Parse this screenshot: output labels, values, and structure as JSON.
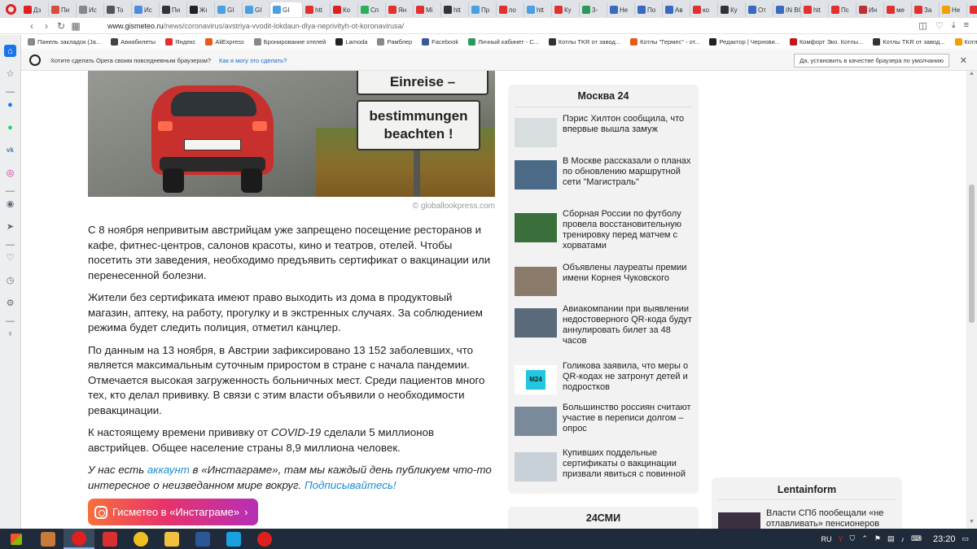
{
  "browser": {
    "tabs": [
      {
        "label": "Дз",
        "color": "#e0201c"
      },
      {
        "label": "Пи",
        "color": "#d84c3c"
      },
      {
        "label": "Ис",
        "color": "#888888"
      },
      {
        "label": "To",
        "color": "#555555"
      },
      {
        "label": "Ис",
        "color": "#4c8be0"
      },
      {
        "label": "Пи",
        "color": "#333333"
      },
      {
        "label": "Жı",
        "color": "#222222"
      },
      {
        "label": "GI",
        "color": "#4aa0e0"
      },
      {
        "label": "GI",
        "color": "#4aa0e0"
      },
      {
        "label": "GI",
        "color": "#4aa0e0"
      },
      {
        "label": "htt",
        "color": "#e03030"
      },
      {
        "label": "Ко",
        "color": "#e02020"
      },
      {
        "label": "Сп",
        "color": "#29b05a"
      },
      {
        "label": "Ян",
        "color": "#e03030"
      },
      {
        "label": "Mi",
        "color": "#e03030"
      },
      {
        "label": "htt",
        "color": "#333333"
      },
      {
        "label": "Пр",
        "color": "#4aa0e0"
      },
      {
        "label": "по",
        "color": "#e03030"
      },
      {
        "label": "htt",
        "color": "#4aa0e0"
      },
      {
        "label": "Ку",
        "color": "#e03030"
      },
      {
        "label": "3-",
        "color": "#2a9a5a"
      },
      {
        "label": "Не",
        "color": "#3a6ac0"
      },
      {
        "label": "По",
        "color": "#3a6ac0"
      },
      {
        "label": "Ав",
        "color": "#3a6ac0"
      },
      {
        "label": "ко",
        "color": "#e03030"
      },
      {
        "label": "Ку",
        "color": "#333333"
      },
      {
        "label": "От",
        "color": "#3a6ac0"
      },
      {
        "label": "IN BC",
        "color": "#3a6ac0"
      },
      {
        "label": "htt",
        "color": "#e03030"
      },
      {
        "label": "Пс",
        "color": "#e03030"
      },
      {
        "label": "Ин",
        "color": "#c03030"
      },
      {
        "label": "ме",
        "color": "#e03030"
      },
      {
        "label": "За",
        "color": "#e03030"
      },
      {
        "label": "Не",
        "color": "#f0a000"
      },
      {
        "label": "Эк",
        "color": "#e03030"
      }
    ],
    "active_tab_index": 9,
    "url_domain": "www.gismeteo.ru",
    "url_path": "/news/coronavirus/avstriya-vvodit-lokdaun-dlya-neprivityh-ot-koronavirusa/",
    "bookmarks": [
      {
        "label": "Панель закладок (Ја...",
        "color": "#888888"
      },
      {
        "label": "Авиабилеты",
        "color": "#444444"
      },
      {
        "label": "Яндекс",
        "color": "#e03030"
      },
      {
        "label": "AliExpress",
        "color": "#e85a1a"
      },
      {
        "label": "Бронирование отелей",
        "color": "#888888"
      },
      {
        "label": "Lamoda",
        "color": "#222222"
      },
      {
        "label": "Рамблер",
        "color": "#888888"
      },
      {
        "label": "Facebook",
        "color": "#3b5998"
      },
      {
        "label": "Личный кабинет - С...",
        "color": "#2a9a5a"
      },
      {
        "label": "Котлы TKR от завод...",
        "color": "#333333"
      },
      {
        "label": "Котлы \"Гермес\" - от...",
        "color": "#e85a1a"
      },
      {
        "label": "Редактор | Чернови...",
        "color": "#222222"
      },
      {
        "label": "Комфорт Эко. Котлы...",
        "color": "#c01818"
      },
      {
        "label": "Котлы TKR от завод...",
        "color": "#333333"
      },
      {
        "label": "Котлы отопления дл...",
        "color": "#f0a000"
      }
    ],
    "opera_bar": {
      "text": "Хотите сделать Opera своим повседневным браузером?",
      "why_link": "Как я могу это сделать?",
      "set_default_button": "Да, установить в качестве браузера по умолчанию"
    }
  },
  "article": {
    "image_sign_top": "Einreise –",
    "image_sign_bottom_1": "bestimmungen",
    "image_sign_bottom_2": "beachten !",
    "image_credit": "© globallookpress.com",
    "paragraphs": [
      "С 8 ноября непривитым австрийцам уже запрещено посещение ресторанов и кафе, фитнес-центров, салонов красоты, кино и театров, отелей. Чтобы посетить эти заведения, необходимо предъявить сертификат о вакцинации или перенесенной болезни.",
      "Жители без сертификата имеют право выходить из дома в продуктовый магазин, аптеку, на работу, прогулку и в экстренных случаях. За соблюдением режима будет следить полиция, отметил канцлер.",
      "По данным на 13 ноября, в Австрии зафиксировано 13 152 заболевших, что является максимальным суточным приростом в стране с начала пандемии. Отмечается высокая загруженность больничных мест. Среди пациентов много тех, кто делал прививку. В связи с этим власти объявили о необходимости ревакцинации."
    ],
    "p4_before": "К настоящему времени прививку от ",
    "p4_em": "COVID-19",
    "p4_after": " сделали 5 миллионов австрийцев. Общее население страны 8,9 миллиона человек.",
    "promo_before": "У нас есть ",
    "promo_link": "аккаунт",
    "promo_middle": " в «Инстаграме», там мы каждый день публикуем что-то интересное о неизведанном мире вокруг. ",
    "promo_subscribe": "Подписывайтесь!",
    "insta_button": "Гисметео в «Инстаграме»"
  },
  "widget_moscow24": {
    "title": "Москва 24",
    "items": [
      {
        "text": "Пэрис Хилтон сообщила, что впервые вышла замуж",
        "thumb": "#d8dde0"
      },
      {
        "text": "В Москве рассказали о планах по обновлению маршрутной сети \"Магистраль\"",
        "thumb": "#4a6a88"
      },
      {
        "text": "Сборная России по футболу провела восстановительную тренировку перед матчем с хорватами",
        "thumb": "#3a6e3a"
      },
      {
        "text": "Объявлены лауреаты премии имени Корнея Чуковского",
        "thumb": "#8a7a6a"
      },
      {
        "text": "Авиакомпании при выявлении недостоверного QR-кода будут аннулировать билет за 48 часов",
        "thumb": "#5a6a7a"
      },
      {
        "text": "Голикова заявила, что меры о QR-кодах не затронут детей и подростков",
        "thumb": "#1fc8e0"
      },
      {
        "text": "Большинство россиян считают участие в переписи долгом – опрос",
        "thumb": "#7a8a9a"
      },
      {
        "text": "Купивших поддельные сертификаты о вакцинации призвали явиться с повинной",
        "thumb": "#c8d0d8"
      }
    ],
    "m24_label": "M24"
  },
  "widget_24smi": {
    "title": "24СМИ"
  },
  "widget_lentainform": {
    "title": "Lentainform",
    "item_text": "Власти СПб пообещали «не отлавливать» пенсионеров",
    "thumb": "#3a3040"
  },
  "taskbar": {
    "apps": [
      {
        "name": "media",
        "color": "#c87a3a"
      },
      {
        "name": "opera",
        "color": "#e0201c"
      },
      {
        "name": "screenshot",
        "color": "#d83030"
      },
      {
        "name": "chrome",
        "color": "#f0c020"
      },
      {
        "name": "explorer",
        "color": "#f0c040"
      },
      {
        "name": "word",
        "color": "#2b5797"
      },
      {
        "name": "ie",
        "color": "#1aa0e0"
      },
      {
        "name": "yandex",
        "color": "#e02020"
      }
    ],
    "active_app_index": 1,
    "lang": "RU",
    "clock": "23:20"
  }
}
